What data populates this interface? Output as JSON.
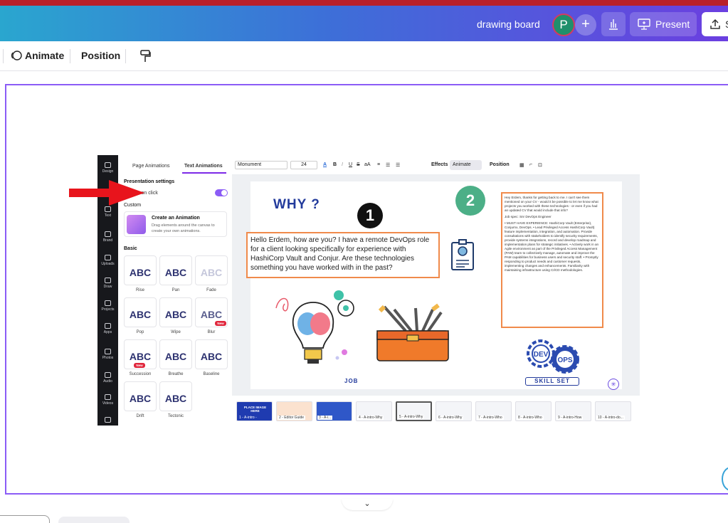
{
  "header": {
    "title": "drawing board",
    "avatar_initial": "P",
    "add_label": "+",
    "present_label": "Present",
    "share_label": "S"
  },
  "toolbar": {
    "animate_label": "Animate",
    "position_label": "Position"
  },
  "screenshot": {
    "rail": [
      "Design",
      "Text",
      "Brand",
      "Uploads",
      "Draw",
      "Projects",
      "Apps",
      "Photos",
      "Audio",
      "Videos"
    ],
    "panel": {
      "tab_page": "Page Animations",
      "tab_text": "Text Animations",
      "presentation_settings": "Presentation settings",
      "appear_on_click": "Appear on click",
      "custom": "Custom",
      "create_title": "Create an Animation",
      "create_desc": "Drag elements around the canvas to create your own animations.",
      "basic": "Basic",
      "animations": [
        {
          "sample": "ABC",
          "label": "Rise"
        },
        {
          "sample": "ABC",
          "label": "Pan"
        },
        {
          "sample": "ABC",
          "label": "Fade"
        },
        {
          "sample": "ABC",
          "label": "Pop"
        },
        {
          "sample": "ABC",
          "label": "Wipe"
        },
        {
          "sample": "ABC",
          "label": "Blur"
        },
        {
          "sample": "ABC",
          "label": "Succession"
        },
        {
          "sample": "ABC",
          "label": "Breathe"
        },
        {
          "sample": "ABC",
          "label": "Baseline"
        },
        {
          "sample": "ABC",
          "label": "Drift"
        },
        {
          "sample": "ABC",
          "label": "Tectonic"
        }
      ],
      "new_badge": "New"
    },
    "inner_toolbar": {
      "font": "Monument",
      "size": "24",
      "effects": "Effects",
      "animate": "Animate",
      "position": "Position"
    },
    "slide": {
      "heading": "WHY ?",
      "marker1": "1",
      "marker2": "2",
      "body": "Hello Erdem, how are you? I have a remote DevOps role for a client looking specifically for experience with HashiCorp Vault and Conjur. Are these technologies something you have worked with in the past?",
      "reply_para1": "Hey Erdem, thanks for getting back to me. I can't see them mentioned on your CV - would it be possible to let me know what projects you worked with these technologies - or even if you had an updated CV that would include that info?",
      "reply_para2": "Job spec: Snr DevOps Engineer",
      "reply_para3": "• MUST HAVE EXPERIENCE: HashiCorp Vault (Enterprise), Conjurnx, DevOps. • Lead Privileged Access HashiCorp Vault) feature implementation, integration, and automation. Provide consultations with stakeholders to identify security requirements, provide systems integrations, record and develop roadmap and implementation plans for strategic initiatives. • Actively work in an Agile environment as part of the Privileged Access Management (PAM) team to collectively manage, automate and improve the PAM capabilities for business users and security staff. • Promptly responding to product needs and customer requests, implementing changes and enhancements. Familiarity with maintaining infrastructure using CI/CD methodologies.",
      "job_label": "JOB",
      "skill_label": "SKILL SET",
      "dev_label": "DEV",
      "ops_label": "OPS"
    },
    "filmstrip": [
      "1 - A-intro -",
      "2 - Editor Guide",
      "3 - A-i...",
      "4 - A-intro-Why",
      "5 - A-intro-Why",
      "6 - A-intro-Why",
      "7 - A-intro-Who",
      "8 - A-intro-Who",
      "9 - A-intro-How",
      "10 - A-intro-do..."
    ],
    "thumb1_text": "PLACE IMAGE HERE"
  },
  "colors": {
    "accent": "#8b5cf6",
    "arrow": "#e8141c",
    "heading": "#233b9c",
    "box_border": "#f08a4b"
  }
}
